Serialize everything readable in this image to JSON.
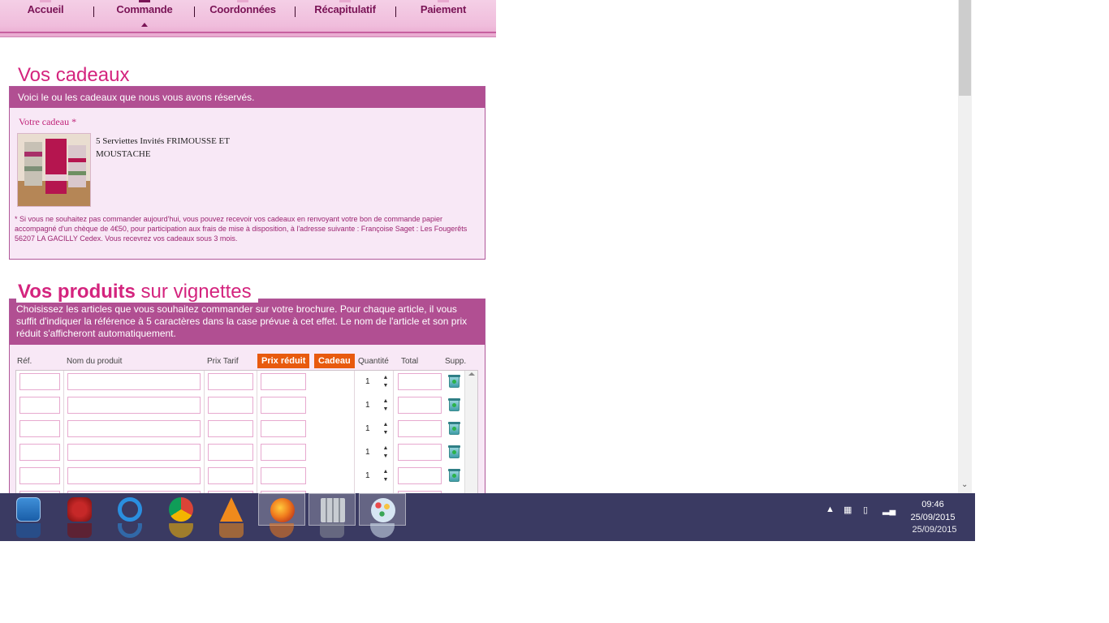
{
  "steps": [
    {
      "label": "Accueil",
      "active": false
    },
    {
      "label": "Commande",
      "active": true
    },
    {
      "label": "Coordonnées",
      "active": false
    },
    {
      "label": "Récapitulatif",
      "active": false
    },
    {
      "label": "Paiement",
      "active": false
    }
  ],
  "gifts": {
    "title": "Vos cadeaux",
    "intro": "Voici le ou les cadeaux que nous vous avons réservés.",
    "gift_label": "Votre cadeau *",
    "gift_name": "5 Serviettes Invités FRIMOUSSE ET MOUSTACHE",
    "note": "* Si vous ne souhaitez pas commander aujourd'hui, vous pouvez recevoir vos cadeaux en renvoyant votre bon de commande papier accompagné d'un chèque de 4€50, pour participation aux frais de mise à disposition, à l'adresse suivante : Françoise Saget : Les Fougerêts 56207 LA GACILLY Cedex. Vous recevrez vos cadeaux sous 3 mois."
  },
  "products": {
    "title_bold": "Vos produits",
    "title_rest": " sur vignettes",
    "intro": "Choisissez les articles que vous souhaitez commander sur votre brochure. Pour chaque article, il vous suffit d'indiquer la référence à 5 caractères dans la case prévue à cet effet. Le nom de l'article et son prix réduit s'afficheront automatiquement.",
    "columns": {
      "ref": "Réf.",
      "name": "Nom du produit",
      "price": "Prix Tarif",
      "reduced": "Prix réduit",
      "gift": "Cadeau",
      "qty": "Quantité",
      "total": "Total",
      "del": "Supp."
    },
    "rows": [
      {
        "ref": "",
        "name": "",
        "price": "",
        "reduced": "",
        "qty": "1",
        "total": ""
      },
      {
        "ref": "",
        "name": "",
        "price": "",
        "reduced": "",
        "qty": "1",
        "total": ""
      },
      {
        "ref": "",
        "name": "",
        "price": "",
        "reduced": "",
        "qty": "1",
        "total": ""
      },
      {
        "ref": "",
        "name": "",
        "price": "",
        "reduced": "",
        "qty": "1",
        "total": ""
      },
      {
        "ref": "",
        "name": "",
        "price": "",
        "reduced": "",
        "qty": "1",
        "total": ""
      }
    ]
  },
  "taskbar": {
    "apps": [
      {
        "icon": "control-panel-icon",
        "open": false,
        "color": "#1f6fbf"
      },
      {
        "icon": "power-icon",
        "open": false,
        "color": "#9e1b1b"
      },
      {
        "icon": "internet-explorer-icon",
        "open": false,
        "color": "#2a8fe0"
      },
      {
        "icon": "chrome-icon",
        "open": false,
        "color": "#3cba54"
      },
      {
        "icon": "vlc-icon",
        "open": false,
        "color": "#f08a1c"
      },
      {
        "icon": "firefox-icon",
        "open": true,
        "color": "#e66000"
      },
      {
        "icon": "file-manager-icon",
        "open": true,
        "color": "#8a8f99"
      },
      {
        "icon": "paint-icon",
        "open": true,
        "color": "#4a9fd8"
      }
    ],
    "time": "09:46",
    "date": "25/09/2015"
  }
}
